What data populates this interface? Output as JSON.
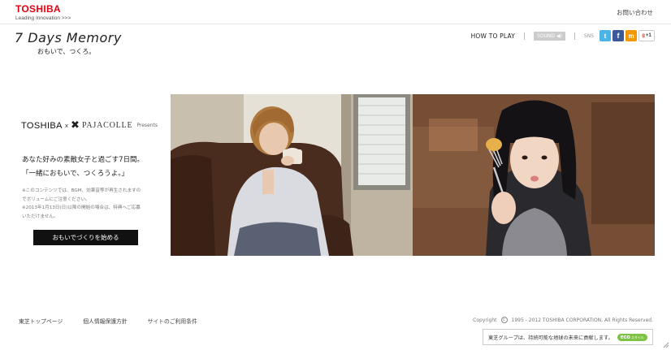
{
  "header": {
    "brand": "TOSHIBA",
    "tagline": "Leading Innovation >>>",
    "contact": "お問い合わせ"
  },
  "hero": {
    "title": "7 Days Memory",
    "subtitle": "おもいで、つくろ。"
  },
  "nav": {
    "how_to_play": "HOW TO PLAY",
    "sound": "SOUND ◀)",
    "sns": "SNS",
    "twitter": "t",
    "facebook": "f",
    "mixi": "m",
    "google_plus": "+1",
    "google_g": "g"
  },
  "collab": {
    "toshiba": "TOSHIBA",
    "x": "x",
    "star": "✖",
    "pajacolle": "PAJACOLLE",
    "presents": "Presents"
  },
  "copy": {
    "line1": "あなた好みの素敵女子と過ごす7日間。",
    "line2": "「一緒におもいで、つくろうよ。」",
    "note1": "※このコンテンツでは、BGM、効果音等が再生されますの",
    "note2": "でボリュームにご注意ください。",
    "note3": "※2013年1月13日(日)以降の開始の場合は、特典へご応募",
    "note4": "いただけません。",
    "cta": "おもいでづくりを始める"
  },
  "footer": {
    "links": [
      "東芝トップページ",
      "個人情報保護方針",
      "サイトのご利用条件"
    ],
    "copyright_prefix": "Copyright",
    "copyright_c": "c",
    "copyright_text": "1995 - 2012 TOSHIBA CORPORATION, All Rights Reserved.",
    "eco_text": "東芝グループは、持続可能な地球の未来に貢献します。",
    "eco_badge": "eco",
    "eco_badge_small": "スタイル"
  },
  "colors": {
    "brand_red": "#e60012",
    "eco_green": "#7cc243",
    "cta_black": "#111111"
  }
}
